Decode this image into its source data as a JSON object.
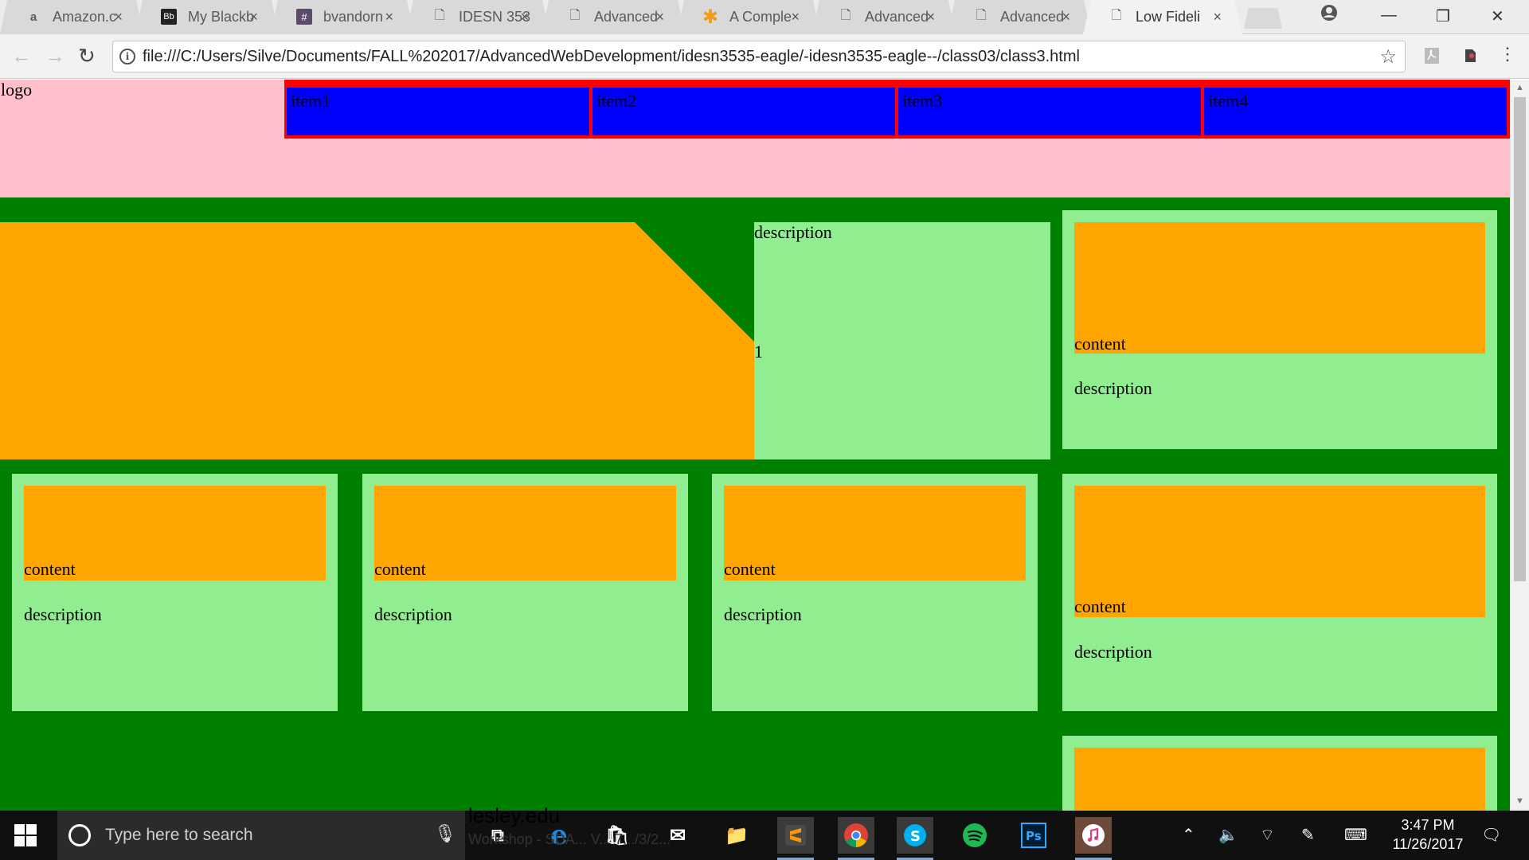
{
  "browser": {
    "tabs": [
      {
        "title": "Amazon.c",
        "icon": "amazon-icon"
      },
      {
        "title": "My Blackb",
        "icon": "blackboard-icon"
      },
      {
        "title": "bvandorn",
        "icon": "slack-icon"
      },
      {
        "title": "IDESN 353",
        "icon": "page-icon"
      },
      {
        "title": "Advanced",
        "icon": "page-icon"
      },
      {
        "title": "A Comple",
        "icon": "asterisk-icon"
      },
      {
        "title": "Advanced",
        "icon": "page-icon"
      },
      {
        "title": "Advanced",
        "icon": "page-icon"
      },
      {
        "title": "Low Fideli",
        "icon": "page-icon"
      }
    ],
    "tab_close": "×",
    "address": "file:///C:/Users/Silve/Documents/FALL%202017/AdvancedWebDevelopment/idesn3535-eagle/-idesn3535-eagle--/class03/class3.html",
    "info_glyph": "i"
  },
  "page": {
    "logo": "logo",
    "nav_items": [
      "item1",
      "item2",
      "item3",
      "item4"
    ],
    "hero": {
      "description": "description",
      "number": "1"
    },
    "card_content": "content",
    "card_description": "description"
  },
  "taskbar": {
    "search_placeholder": "Type here to search",
    "time": "3:47 PM",
    "date": "11/26/2017",
    "background_text": "lesley.edu",
    "background_text2": "Workshop - SDA... V... 7.../3/2..."
  },
  "colors": {
    "header": "#ffc0cb",
    "nav": "#0000ff",
    "nav_border": "#ff0000",
    "main": "#008000",
    "card": "#90ee90",
    "media": "#ffa500"
  }
}
